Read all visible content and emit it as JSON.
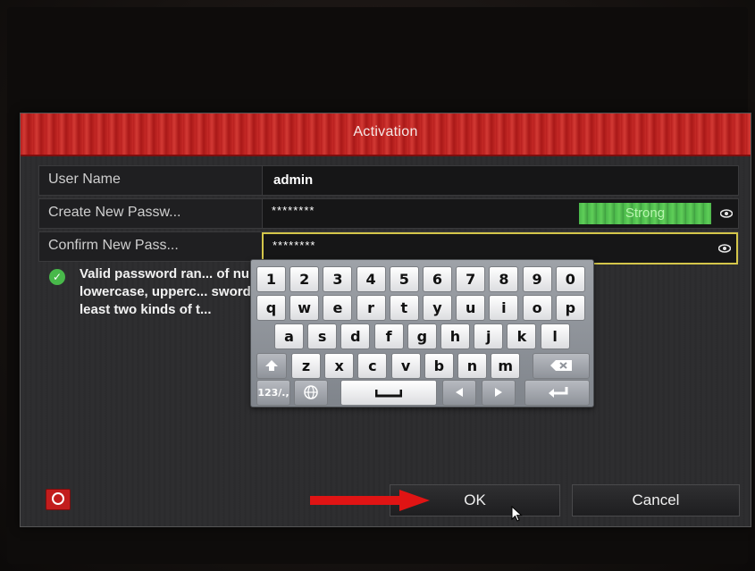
{
  "dialog": {
    "title": "Activation",
    "fields": {
      "username": {
        "label": "User Name",
        "value": "admin"
      },
      "new_password": {
        "label": "Create New Passw...",
        "value": "********",
        "strength": "Strong"
      },
      "confirm_password": {
        "label": "Confirm New Pass...",
        "value": "********"
      }
    },
    "notice": {
      "line1": "Valid password ran... of numbers,",
      "line2": "lowercase, upperc... sword with at",
      "line3": "least two kinds of t..."
    },
    "buttons": {
      "ok": "OK",
      "cancel": "Cancel"
    }
  },
  "keyboard": {
    "row1": [
      "1",
      "2",
      "3",
      "4",
      "5",
      "6",
      "7",
      "8",
      "9",
      "0"
    ],
    "row2": [
      "q",
      "w",
      "e",
      "r",
      "t",
      "y",
      "u",
      "i",
      "o",
      "p"
    ],
    "row3": [
      "a",
      "s",
      "d",
      "f",
      "g",
      "h",
      "j",
      "k",
      "l"
    ],
    "row4": [
      "z",
      "x",
      "c",
      "v",
      "b",
      "n",
      "m"
    ],
    "mode_key": "123/.,",
    "icons": [
      "shift-icon",
      "backspace-icon",
      "globe-icon",
      "space-icon",
      "arrow-left-icon",
      "arrow-right-icon",
      "enter-icon"
    ]
  },
  "colors": {
    "title_bar": "#c52a26",
    "strength_bar": "#49b64a",
    "focus_border": "#d4c64a",
    "annotation_arrow": "#e01414"
  }
}
